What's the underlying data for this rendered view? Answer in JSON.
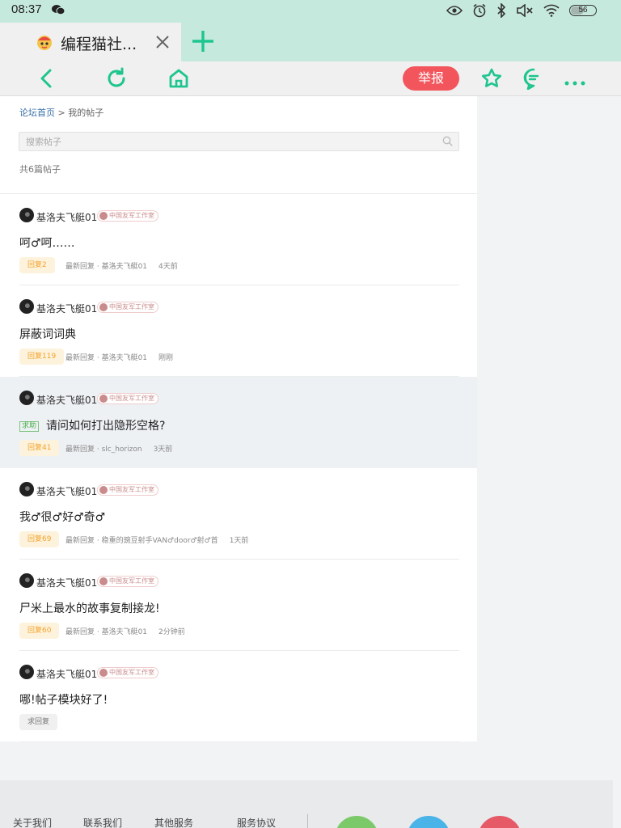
{
  "status_bar": {
    "time": "08:37",
    "battery": "56",
    "battery_level": 0.56
  },
  "browser": {
    "tab_title": "编程猫社...",
    "report_label": "举报"
  },
  "breadcrumb": {
    "home": "论坛首页",
    "separator": " > ",
    "current": "我的帖子"
  },
  "search": {
    "placeholder": "搜索帖子"
  },
  "count_text": "共6篇帖子",
  "posts": [
    {
      "author": "基洛夫飞艇01",
      "badge": "中国友军工作室",
      "tag": "",
      "title": "呵♂呵……",
      "reply": "回复2",
      "meta": "最新回复 · 基洛夫飞艇01",
      "time": "4天前"
    },
    {
      "author": "基洛夫飞艇01",
      "badge": "中国友军工作室",
      "tag": "",
      "title": "屏蔽词词典",
      "reply": "回复119",
      "meta": "最新回复 · 基洛夫飞艇01",
      "time": "刚刚"
    },
    {
      "author": "基洛夫飞艇01",
      "badge": "中国友军工作室",
      "tag": "求助",
      "title": "请问如何打出隐形空格?",
      "reply": "回复41",
      "meta": "最新回复 · slc_horizon",
      "time": "3天前"
    },
    {
      "author": "基洛夫飞艇01",
      "badge": "中国友军工作室",
      "tag": "",
      "title": "我♂很♂好♂奇♂",
      "reply": "回复69",
      "meta": "最新回复 · 稳重的豌豆射手VAN♂door♂射♂首",
      "time": "1天前"
    },
    {
      "author": "基洛夫飞艇01",
      "badge": "中国友军工作室",
      "tag": "",
      "title": "尸米上最水的故事复制接龙!",
      "reply": "回复60",
      "meta": "最新回复 · 基洛夫飞艇01",
      "time": "2分钟前"
    },
    {
      "author": "基洛夫飞艇01",
      "badge": "中国友军工作室",
      "tag": "",
      "title": "哪!帖子模块好了!",
      "reply": "求回复",
      "meta": "",
      "time": ""
    }
  ],
  "footer": {
    "about": "关于我们",
    "contact": "联系我们",
    "services": "其他服务",
    "agreement": "服务协议"
  },
  "colors": {
    "accent": "#1ec58e",
    "report": "#f2565c",
    "status_bg": "#c6e9dd"
  }
}
